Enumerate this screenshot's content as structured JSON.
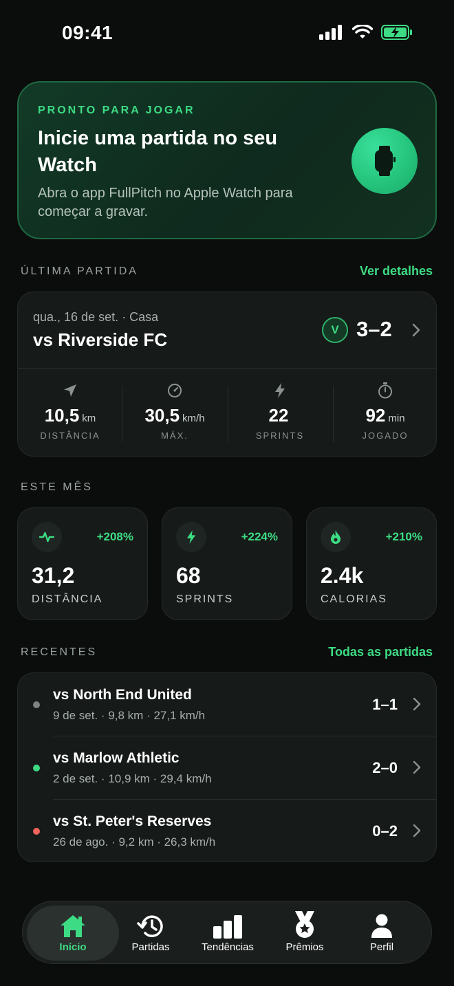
{
  "status_bar": {
    "time": "09:41"
  },
  "hero": {
    "kicker": "PRONTO PARA JOGAR",
    "title": "Inicie uma partida no seu Watch",
    "subtitle": "Abra o app FullPitch no Apple Watch para começar a gravar."
  },
  "last_match_section": {
    "label": "ÚLTIMA PARTIDA",
    "link": "Ver detalhes"
  },
  "last_match": {
    "date": "qua., 16 de set. · Casa",
    "opponent": "vs Riverside FC",
    "result": "V",
    "score": "3–2",
    "stats": [
      {
        "icon": "location-arrow-icon",
        "value": "10,5",
        "unit": "km",
        "label": "DISTÂNCIA"
      },
      {
        "icon": "speedometer-icon",
        "value": "30,5",
        "unit": "km/h",
        "label": "MÁX."
      },
      {
        "icon": "bolt-icon",
        "value": "22",
        "unit": "",
        "label": "SPRINTS"
      },
      {
        "icon": "stopwatch-icon",
        "value": "92",
        "unit": "min",
        "label": "JOGADO"
      }
    ]
  },
  "month_section": {
    "label": "ESTE MÊS"
  },
  "month_stats": [
    {
      "icon": "heartbeat-icon",
      "delta": "+208%",
      "value": "31,2",
      "label": "DISTÂNCIA"
    },
    {
      "icon": "bolt-icon",
      "delta": "+224%",
      "value": "68",
      "label": "SPRINTS"
    },
    {
      "icon": "flame-icon",
      "delta": "+210%",
      "value": "2.4k",
      "label": "CALORIAS"
    }
  ],
  "recent_section": {
    "label": "RECENTES",
    "link": "Todas as partidas"
  },
  "recent_matches": [
    {
      "opponent": "vs North End United",
      "meta": "9 de set. · 9,8 km · 27,1 km/h",
      "score": "1–1",
      "result_color": "#7d8380"
    },
    {
      "opponent": "vs Marlow Athletic",
      "meta": "2 de set. · 10,9 km · 29,4 km/h",
      "score": "2–0",
      "result_color": "#3ddc84"
    },
    {
      "opponent": "vs St. Peter's Reserves",
      "meta": "26 de ago. · 9,2 km · 26,3 km/h",
      "score": "0–2",
      "result_color": "#f0645c"
    }
  ],
  "tabs": [
    {
      "label": "Início",
      "icon": "home-icon",
      "active": true
    },
    {
      "label": "Partidas",
      "icon": "history-icon",
      "active": false
    },
    {
      "label": "Tendências",
      "icon": "bar-chart-icon",
      "active": false
    },
    {
      "label": "Prêmios",
      "icon": "medal-icon",
      "active": false
    },
    {
      "label": "Perfil",
      "icon": "person-icon",
      "active": false
    }
  ],
  "colors": {
    "accent": "#3ddc84",
    "background": "#0b0d0c",
    "card": "#161a18"
  }
}
